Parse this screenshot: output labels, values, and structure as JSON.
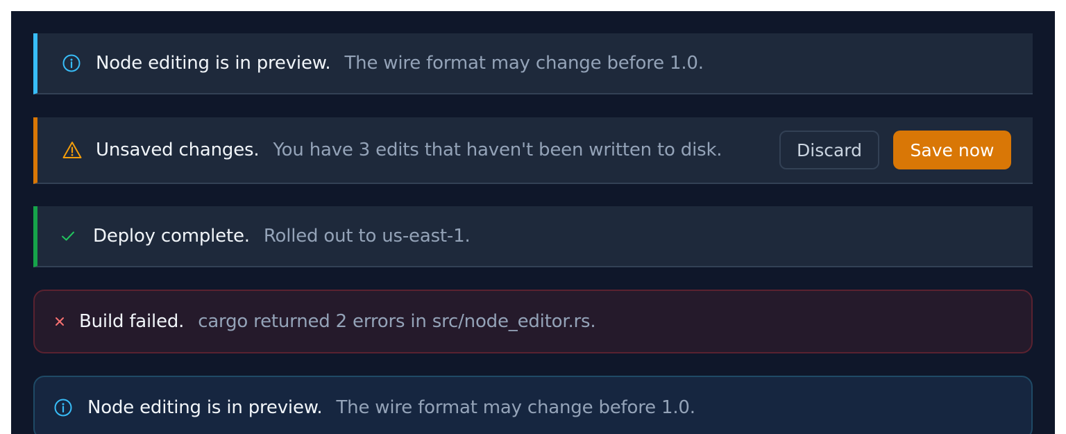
{
  "banners": [
    {
      "kind": "info",
      "icon": "info-icon",
      "title": "Node editing is in preview.",
      "message": "The wire format may change before 1.0."
    },
    {
      "kind": "warning",
      "icon": "warning-icon",
      "title": "Unsaved changes.",
      "message": "You have 3 edits that haven't been written to disk.",
      "actions": {
        "discard_label": "Discard",
        "save_label": "Save now"
      }
    },
    {
      "kind": "success",
      "icon": "check-icon",
      "title": "Deploy complete.",
      "message": "Rolled out to us-east-1."
    },
    {
      "kind": "error",
      "icon": "close-icon",
      "title": "Build failed.",
      "message": "cargo returned 2 errors in src/node_editor.rs."
    },
    {
      "kind": "info",
      "icon": "info-icon",
      "title": "Node editing is in preview.",
      "message": "The wire format may change before 1.0."
    }
  ],
  "colors": {
    "info": "#38bdf8",
    "warning": "#d97706",
    "success": "#16a34a",
    "error": "#f87171",
    "background": "#0f172a"
  }
}
